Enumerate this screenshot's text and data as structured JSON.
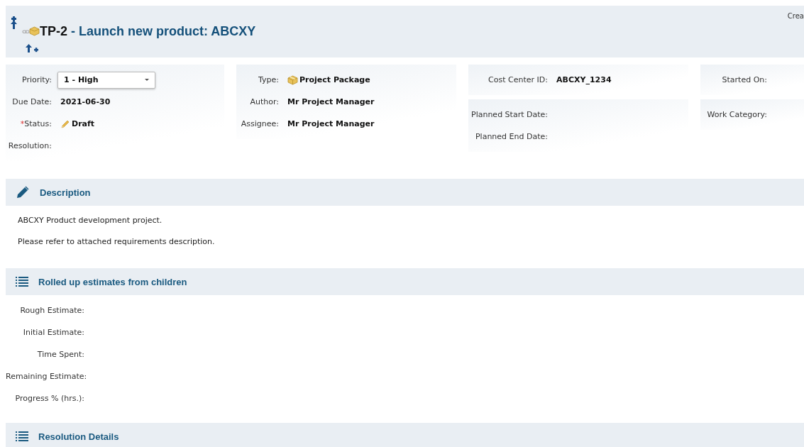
{
  "header": {
    "key": "TP-2",
    "separator": " - ",
    "title": "Launch new product: ABCXY",
    "corner_text": "Crea"
  },
  "field_columns": [
    {
      "groups": [
        {
          "fields": [
            {
              "label": "Priority:",
              "kind": "select",
              "value": "1 - High"
            },
            {
              "label": "Due Date:",
              "kind": "text",
              "value": "2021-06-30"
            },
            {
              "label": "Status:",
              "marker": "*",
              "kind": "status",
              "value": "Draft"
            },
            {
              "label": "Resolution:"
            }
          ]
        }
      ]
    },
    {
      "groups": [
        {
          "fields": [
            {
              "label": "Type:",
              "kind": "package",
              "value": "Project Package"
            },
            {
              "label": "Author:",
              "kind": "text",
              "value": "Mr Project Manager"
            },
            {
              "label": "Assignee:",
              "kind": "text",
              "value": "Mr Project Manager"
            }
          ]
        }
      ]
    },
    {
      "groups": [
        {
          "fields": [
            {
              "label": "Cost Center ID:",
              "kind": "text",
              "value": "ABCXY_1234"
            }
          ]
        },
        {
          "fields": [
            {
              "label": "Planned Start Date:"
            },
            {
              "label": "Planned End Date:"
            }
          ]
        }
      ]
    },
    {
      "groups": [
        {
          "fields": [
            {
              "label": "Started On:"
            }
          ]
        },
        {
          "fields": [
            {
              "label": "Work Category:"
            }
          ]
        }
      ]
    }
  ],
  "sections": [
    {
      "title": "Description",
      "kind": "text",
      "paragraphs": [
        "ABCXY Product development project.",
        "Please refer to attached requirements description."
      ]
    },
    {
      "title": "Rolled up estimates from children",
      "kind": "list",
      "fields": [
        "Rough Estimate:",
        "Initial Estimate:",
        "Time Spent:",
        "Remaining Estimate:",
        "Progress % (hrs.):"
      ]
    },
    {
      "title": "Resolution Details",
      "kind": "list"
    }
  ]
}
